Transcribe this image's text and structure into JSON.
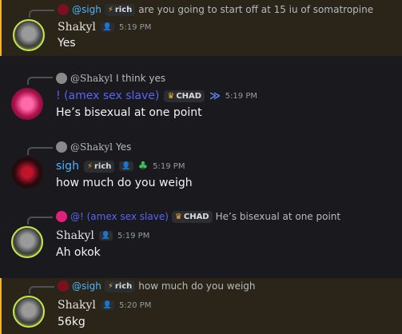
{
  "messages": [
    {
      "reply": {
        "name": "@sigh",
        "tag": "rich",
        "text": "are you going to start off at 15 iu of somatropine"
      },
      "author": "Shakyl",
      "time": "5:19 PM",
      "content": "Yes"
    },
    {
      "reply": {
        "name": "@Shakyl",
        "text": "I think yes"
      },
      "author": "! (amex sex slave)",
      "tag": "CHAD",
      "time": "5:19 PM",
      "content": "He’s bisexual at one point"
    },
    {
      "reply": {
        "name": "@Shakyl",
        "text": "Yes"
      },
      "author": "sigh",
      "tag": "rich",
      "time": "5:19 PM",
      "content": "how much do you weigh"
    },
    {
      "reply": {
        "name": "@! (amex sex slave)",
        "tag": "CHAD",
        "text": "He’s bisexual at one point"
      },
      "author": "Shakyl",
      "time": "5:19 PM",
      "content": "Ah okok"
    },
    {
      "reply": {
        "name": "@sigh",
        "tag": "rich",
        "text": "how much do you weigh"
      },
      "author": "Shakyl",
      "time": "5:20 PM",
      "content": "56kg"
    }
  ],
  "icons": {
    "lightning": "⚡",
    "person": "👤",
    "crown": "♛",
    "wings": "≫"
  },
  "colors": {
    "highlight_bg": "#2a2518",
    "highlight_bar": "#f0b232",
    "amex_name": "#5865f2",
    "sigh_name": "#4fb3ff"
  }
}
